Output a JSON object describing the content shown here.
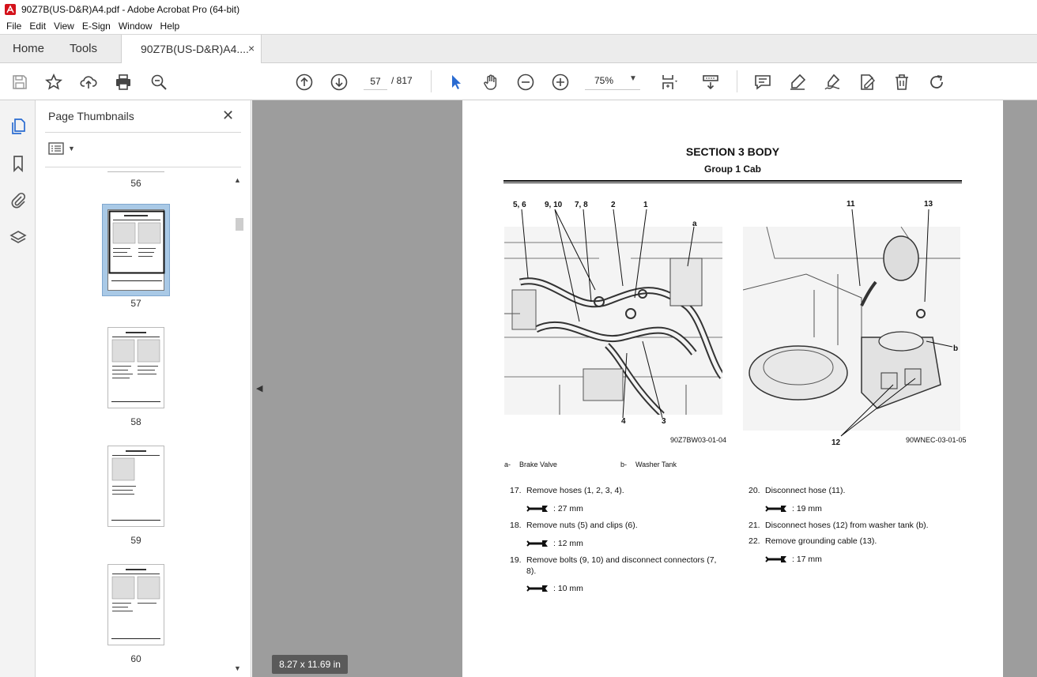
{
  "window": {
    "title": "90Z7B(US-D&R)A4.pdf - Adobe Acrobat Pro (64-bit)"
  },
  "menu": [
    "File",
    "Edit",
    "View",
    "E-Sign",
    "Window",
    "Help"
  ],
  "tabs": {
    "home": "Home",
    "tools": "Tools",
    "document": "90Z7B(US-D&R)A4....",
    "close": "×"
  },
  "toolbar": {
    "page_current": "57",
    "page_sep_total": "/  817",
    "zoom": "75%",
    "icons": [
      "save-icon",
      "star-icon",
      "upload-icon",
      "print-icon",
      "zoom-search-icon",
      "prev-page-icon",
      "next-page-icon",
      "select-cursor-icon",
      "hand-icon",
      "zoom-out-icon",
      "zoom-in-icon",
      "page-fit-icon",
      "scroll-mode-icon",
      "comment-icon",
      "highlight-icon",
      "sign-icon",
      "fill-sign-icon",
      "delete-icon",
      "rotate-icon"
    ]
  },
  "sidebar": {
    "title": "Page Thumbnails",
    "close": "✕",
    "thumbnails": [
      {
        "label": "56"
      },
      {
        "label": "57",
        "selected": true
      },
      {
        "label": "58"
      },
      {
        "label": "59"
      },
      {
        "label": "60"
      }
    ]
  },
  "document": {
    "section": "SECTION 3 BODY",
    "group": "Group 1 Cab",
    "figure_left": {
      "callouts": [
        "5, 6",
        "9, 10",
        "7, 8",
        "2",
        "1",
        "a",
        "4",
        "3"
      ],
      "id": "90Z7BW03-01-04"
    },
    "figure_right": {
      "callouts": [
        "11",
        "13",
        "b",
        "12"
      ],
      "id": "90WNEC-03-01-05"
    },
    "legend": [
      {
        "key": "a-",
        "text": "Brake Valve"
      },
      {
        "key": "b-",
        "text": "Washer Tank"
      }
    ],
    "steps_left": [
      {
        "num": "17.",
        "text": "Remove hoses (1, 2, 3, 4).",
        "spec": ": 27 mm"
      },
      {
        "num": "18.",
        "text": "Remove nuts (5) and clips (6).",
        "spec": ": 12 mm"
      },
      {
        "num": "19.",
        "text": "Remove bolts (9, 10) and disconnect connectors (7,",
        "text2": "8).",
        "spec": ": 10 mm"
      }
    ],
    "steps_right": [
      {
        "num": "20.",
        "text": "Disconnect hose (11).",
        "spec": ": 19 mm"
      },
      {
        "num": "21.",
        "text": "Disconnect hoses (12) from washer tank (b)."
      },
      {
        "num": "22.",
        "text": "Remove grounding cable (13).",
        "spec": ": 17 mm"
      }
    ],
    "page_size": "8.27 x 11.69 in"
  }
}
